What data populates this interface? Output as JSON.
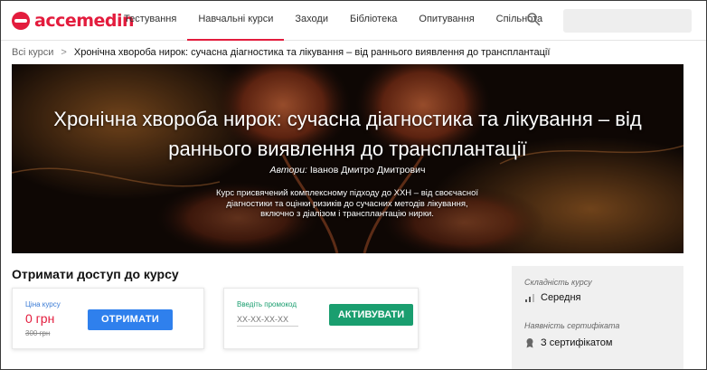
{
  "brand": {
    "name": "accemedin",
    "color": "#e31c3d"
  },
  "nav": {
    "items": [
      {
        "label": "Тестування",
        "active": false
      },
      {
        "label": "Навчальні курси",
        "active": true
      },
      {
        "label": "Заходи",
        "active": false
      },
      {
        "label": "Бібліотека",
        "active": false
      },
      {
        "label": "Опитування",
        "active": false
      },
      {
        "label": "Спільнота",
        "active": false
      }
    ],
    "search_icon": "search-icon"
  },
  "breadcrumb": {
    "root": "Всі курси",
    "separator": ">",
    "current": "Хронічна хвороба нирок: сучасна діагностика та лікування – від раннього виявлення до трансплантації"
  },
  "hero": {
    "title": "Хронічна хвороба нирок: сучасна діагностика та лікування – від раннього виявлення до трансплантації",
    "authors_label": "Автори:",
    "authors": "Іванов Дмитро Дмитрович",
    "description": "Курс присвячений комплексному підходу до ХХН – від своєчасної діагностики та оцінки ризиків до сучасних методів лікування, включно з діалізом і трансплантацію нирки."
  },
  "access": {
    "title": "Отримати доступ до курсу",
    "price": {
      "label": "Ціна курсу",
      "value": "0 грн",
      "old_value": "300 грн",
      "button": "ОТРИМАТИ"
    },
    "promo": {
      "label": "Введіть промокод",
      "placeholder": "XX-XX-XX-XX",
      "button": "АКТИВУВАТИ"
    }
  },
  "info": {
    "difficulty_label": "Складність курсу",
    "difficulty_value": "Середня",
    "difficulty_icon": "signal-bars-icon",
    "certificate_label": "Наявність сертифіката",
    "certificate_value": "З сертифікатом",
    "certificate_icon": "award-icon"
  },
  "colors": {
    "accent_red": "#e31c3d",
    "button_blue": "#2f80ed",
    "button_green": "#1a9e6f"
  }
}
